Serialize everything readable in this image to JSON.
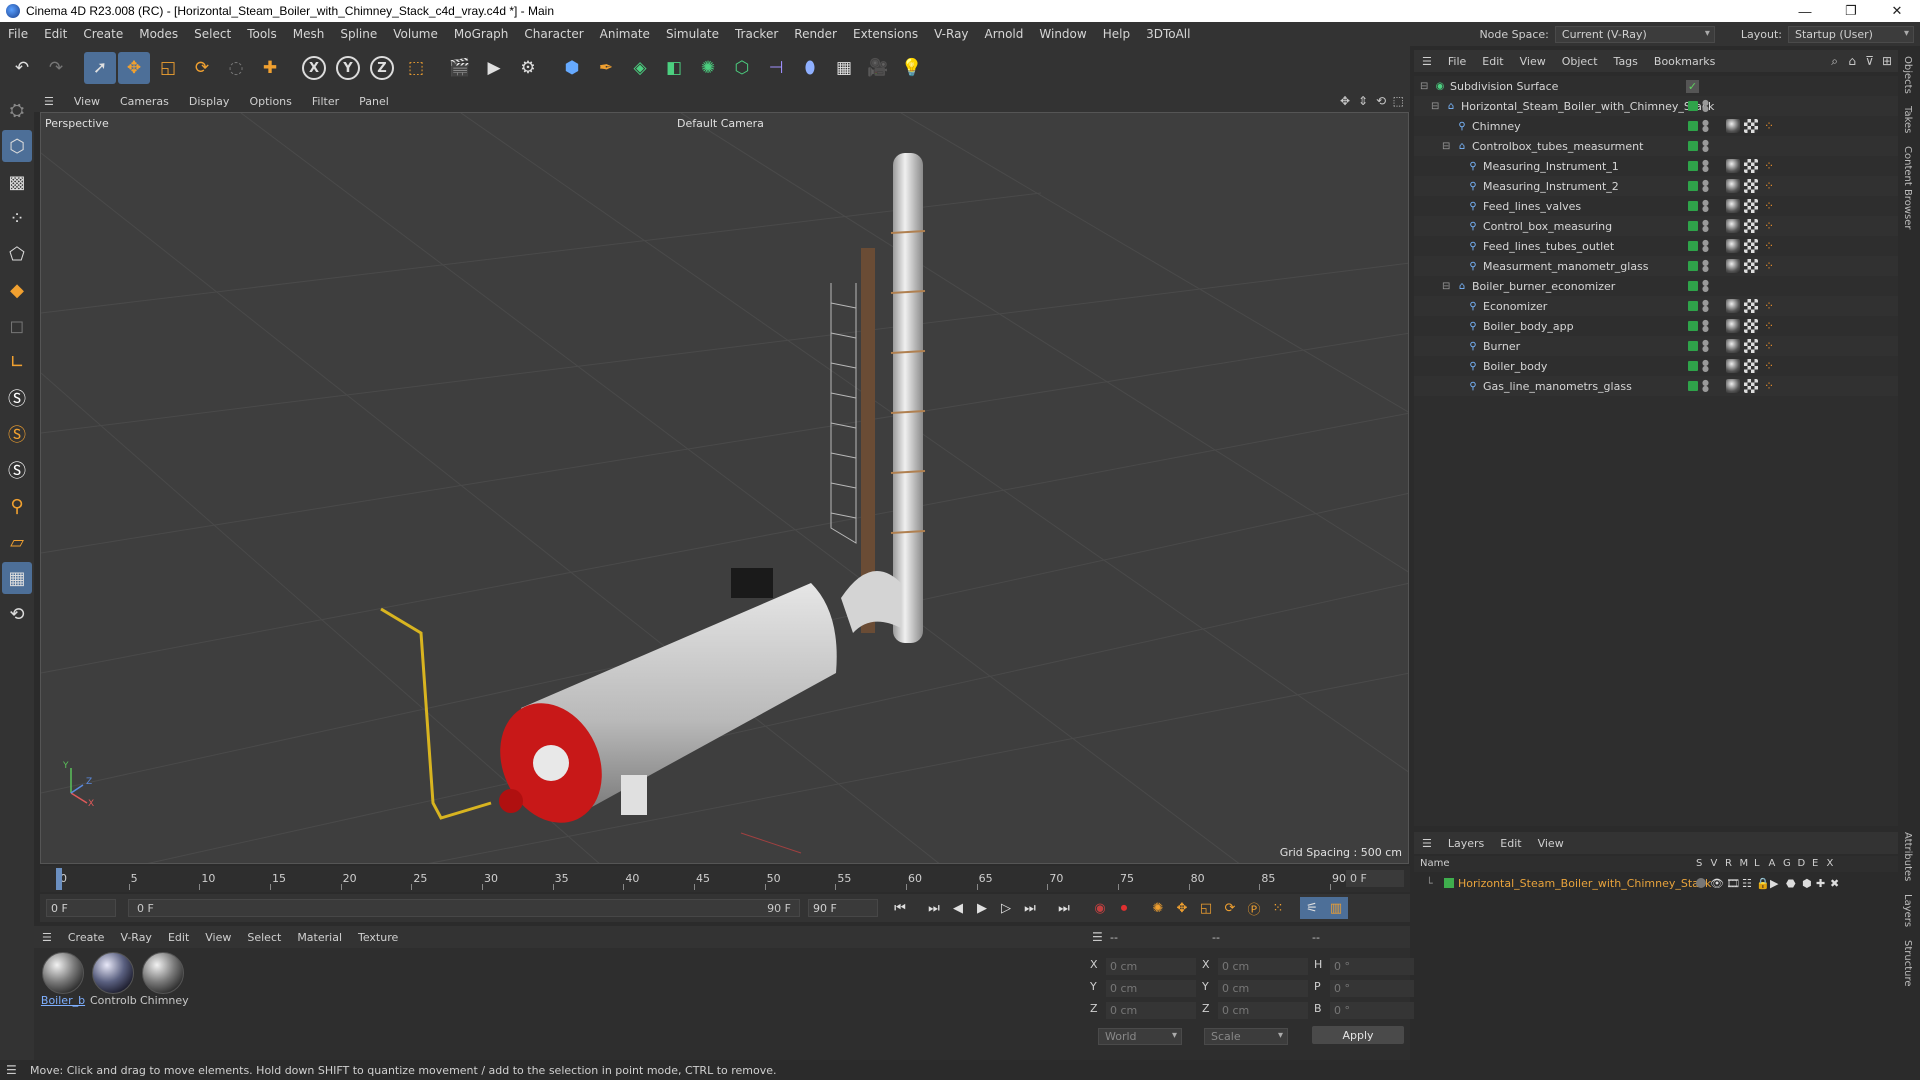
{
  "window": {
    "title": "Cinema 4D R23.008 (RC) - [Horizontal_Steam_Boiler_with_Chimney_Stack_c4d_vray.c4d *] - Main",
    "controls": [
      "—",
      "❐",
      "✕"
    ]
  },
  "menubar": {
    "items": [
      "File",
      "Edit",
      "Create",
      "Modes",
      "Select",
      "Tools",
      "Mesh",
      "Spline",
      "Volume",
      "MoGraph",
      "Character",
      "Animate",
      "Simulate",
      "Tracker",
      "Render",
      "Extensions",
      "V-Ray",
      "Arnold",
      "Window",
      "Help",
      "3DToAll"
    ],
    "node_space_label": "Node Space:",
    "node_space_value": "Current (V-Ray)",
    "layout_label": "Layout:",
    "layout_value": "Startup (User)"
  },
  "viewport": {
    "menu": [
      "View",
      "Cameras",
      "Display",
      "Options",
      "Filter",
      "Panel"
    ],
    "label": "Perspective",
    "camera": "Default Camera",
    "grid_spacing": "Grid Spacing : 500 cm",
    "axis_x": "X",
    "axis_y": "Y",
    "axis_z": "Z"
  },
  "timeline": {
    "ticks": [
      "0",
      "5",
      "10",
      "15",
      "20",
      "25",
      "30",
      "35",
      "40",
      "45",
      "50",
      "55",
      "60",
      "65",
      "70",
      "75",
      "80",
      "85",
      "90"
    ],
    "end_field": "0 F",
    "start_frame": "0 F",
    "range_start": "0 F",
    "range_end": "90 F",
    "max_frame": "90 F"
  },
  "materials": {
    "menu": [
      "Create",
      "V-Ray",
      "Edit",
      "View",
      "Select",
      "Material",
      "Texture"
    ],
    "items": [
      "Boiler_b",
      "Controlb",
      "Chimney"
    ]
  },
  "coordinates": {
    "headers": [
      "--",
      "--",
      "--"
    ],
    "rows": [
      {
        "a": "X",
        "av": "0 cm",
        "b": "X",
        "bv": "0 cm",
        "c": "H",
        "cv": "0 °"
      },
      {
        "a": "Y",
        "av": "0 cm",
        "b": "Y",
        "bv": "0 cm",
        "c": "P",
        "cv": "0 °"
      },
      {
        "a": "Z",
        "av": "0 cm",
        "b": "Z",
        "bv": "0 cm",
        "c": "B",
        "cv": "0 °"
      }
    ],
    "space": "World",
    "mode": "Scale",
    "apply": "Apply"
  },
  "status": "Move: Click and drag to move elements. Hold down SHIFT to quantize movement / add to the selection in point mode, CTRL to remove.",
  "object_manager": {
    "menu": [
      "File",
      "Edit",
      "View",
      "Object",
      "Tags",
      "Bookmarks"
    ],
    "objects": [
      {
        "name": "Subdivision Surface",
        "indent": 0,
        "icon": "subdivision-icon",
        "tags": false,
        "expander": "⊟"
      },
      {
        "name": "Horizontal_Steam_Boiler_with_Chimney_Stack",
        "indent": 1,
        "icon": "null-icon",
        "tags": false,
        "expander": "⊟"
      },
      {
        "name": "Chimney",
        "indent": 2,
        "icon": "polygon-icon",
        "tags": true,
        "expander": ""
      },
      {
        "name": "Controlbox_tubes_measurment",
        "indent": 2,
        "icon": "null-icon",
        "tags": false,
        "expander": "⊟"
      },
      {
        "name": "Measuring_Instrument_1",
        "indent": 3,
        "icon": "polygon-icon",
        "tags": true,
        "expander": ""
      },
      {
        "name": "Measuring_Instrument_2",
        "indent": 3,
        "icon": "polygon-icon",
        "tags": true,
        "expander": ""
      },
      {
        "name": "Feed_lines_valves",
        "indent": 3,
        "icon": "polygon-icon",
        "tags": true,
        "expander": ""
      },
      {
        "name": "Control_box_measuring",
        "indent": 3,
        "icon": "polygon-icon",
        "tags": true,
        "expander": ""
      },
      {
        "name": "Feed_lines_tubes_outlet",
        "indent": 3,
        "icon": "polygon-icon",
        "tags": true,
        "expander": ""
      },
      {
        "name": "Measurment_manometr_glass",
        "indent": 3,
        "icon": "polygon-icon",
        "tags": true,
        "expander": ""
      },
      {
        "name": "Boiler_burner_economizer",
        "indent": 2,
        "icon": "null-icon",
        "tags": false,
        "expander": "⊟"
      },
      {
        "name": "Economizer",
        "indent": 3,
        "icon": "polygon-icon",
        "tags": true,
        "expander": ""
      },
      {
        "name": "Boiler_body_app",
        "indent": 3,
        "icon": "polygon-icon",
        "tags": true,
        "expander": ""
      },
      {
        "name": "Burner",
        "indent": 3,
        "icon": "polygon-icon",
        "tags": true,
        "expander": ""
      },
      {
        "name": "Boiler_body",
        "indent": 3,
        "icon": "polygon-icon",
        "tags": true,
        "expander": ""
      },
      {
        "name": "Gas_line_manometrs_glass",
        "indent": 3,
        "icon": "polygon-icon",
        "tags": true,
        "expander": ""
      }
    ]
  },
  "layers": {
    "menu": [
      "Layers",
      "Edit",
      "View"
    ],
    "col_name": "Name",
    "col_flags": [
      "S",
      "V",
      "R",
      "M",
      "L",
      "A",
      "G",
      "D",
      "E",
      "X"
    ],
    "items": [
      {
        "name": "Horizontal_Steam_Boiler_with_Chimney_Stack"
      }
    ]
  },
  "side_tabs": [
    "Objects",
    "Takes",
    "Content Browser",
    "Attributes",
    "Layers",
    "Structure"
  ]
}
